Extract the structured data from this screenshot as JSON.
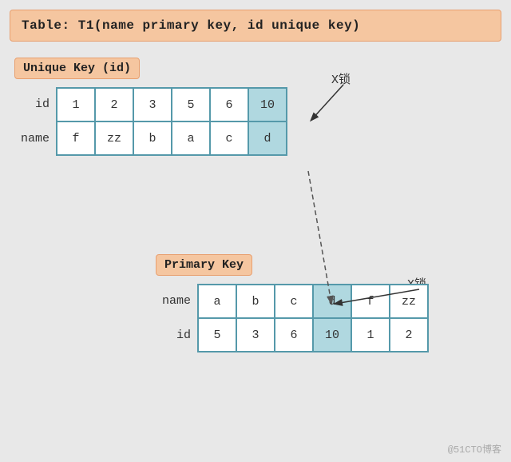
{
  "title": "Table: T1(name primary key,  id unique key)",
  "uniqueKey": {
    "label": "Unique Key (id)",
    "rows": [
      {
        "label": "id",
        "cells": [
          {
            "value": "1",
            "highlight": false
          },
          {
            "value": "2",
            "highlight": false
          },
          {
            "value": "3",
            "highlight": false
          },
          {
            "value": "5",
            "highlight": false
          },
          {
            "value": "6",
            "highlight": false
          },
          {
            "value": "10",
            "highlight": true
          }
        ]
      },
      {
        "label": "name",
        "cells": [
          {
            "value": "f",
            "highlight": false
          },
          {
            "value": "zz",
            "highlight": false
          },
          {
            "value": "b",
            "highlight": false
          },
          {
            "value": "a",
            "highlight": false
          },
          {
            "value": "c",
            "highlight": false
          },
          {
            "value": "d",
            "highlight": true
          }
        ]
      }
    ]
  },
  "primaryKey": {
    "label": "Primary Key",
    "rows": [
      {
        "label": "name",
        "cells": [
          {
            "value": "a",
            "highlight": false
          },
          {
            "value": "b",
            "highlight": false
          },
          {
            "value": "c",
            "highlight": false
          },
          {
            "value": "d",
            "highlight": true
          },
          {
            "value": "f",
            "highlight": false
          },
          {
            "value": "zz",
            "highlight": false
          }
        ]
      },
      {
        "label": "id",
        "cells": [
          {
            "value": "5",
            "highlight": false
          },
          {
            "value": "3",
            "highlight": false
          },
          {
            "value": "6",
            "highlight": false
          },
          {
            "value": "10",
            "highlight": true
          },
          {
            "value": "1",
            "highlight": false
          },
          {
            "value": "2",
            "highlight": false
          }
        ]
      }
    ]
  },
  "xLockLabels": [
    "X锁",
    "X锁"
  ],
  "watermark": "@51CTO博客"
}
